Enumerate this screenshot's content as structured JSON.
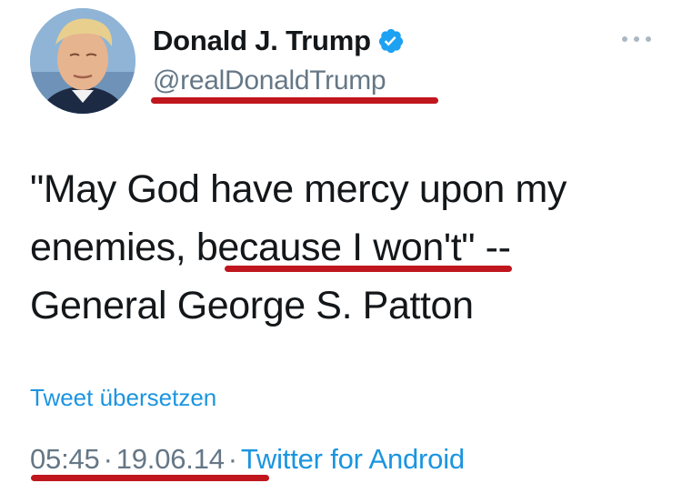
{
  "author": {
    "display_name": "Donald J. Trump",
    "handle": "@realDonaldTrump",
    "verified": true
  },
  "tweet": {
    "lines": [
      "\"May God have mercy upon my",
      "enemies, because I won't\" --",
      "General George S. Patton"
    ],
    "translate_label": "Tweet übersetzen",
    "time": "05:45",
    "date": "19.06.14",
    "separator": "·",
    "source": "Twitter for Android"
  },
  "icons": {
    "verified": "verified-badge-icon",
    "more": "more-options-icon"
  },
  "colors": {
    "text": "#14171a",
    "muted": "#657786",
    "link": "#1b95e0",
    "verified": "#1da1f2",
    "annotation": "#c0161d"
  }
}
